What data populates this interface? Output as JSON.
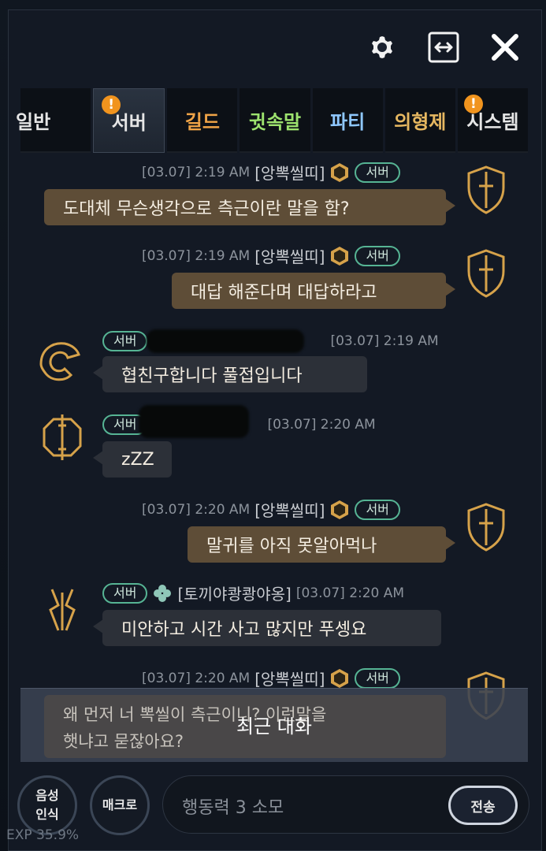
{
  "tabs": [
    {
      "label": "일반",
      "color": "#e6e6e6",
      "badge": ""
    },
    {
      "label": "서버",
      "color": "#e6e6e6",
      "badge": "!"
    },
    {
      "label": "길드",
      "color": "#f0a447",
      "badge": ""
    },
    {
      "label": "귓속말",
      "color": "#9de36e",
      "badge": ""
    },
    {
      "label": "파티",
      "color": "#8fc8ff",
      "badge": ""
    },
    {
      "label": "의형제",
      "color": "#e7b861",
      "badge": ""
    },
    {
      "label": "시스템",
      "color": "#e6e6e6",
      "badge": "!"
    }
  ],
  "messages": [
    {
      "time": "[03.07] 2:19 AM",
      "sender": "[앙뽁씰띠]",
      "channel": "서버",
      "text": "도대체 무슨생각으로 측근이란 말을 함?"
    },
    {
      "time": "[03.07] 2:19 AM",
      "sender": "[앙뽁씰띠]",
      "channel": "서버",
      "text": "대답 해준다며 대답하라고"
    },
    {
      "time": "[03.07] 2:19 AM",
      "channel": "서버",
      "text": "협친구합니다 풀접입니다"
    },
    {
      "time": "[03.07] 2:20 AM",
      "channel": "서버",
      "text": "zZZ"
    },
    {
      "time": "[03.07] 2:20 AM",
      "sender": "[앙뽁씰띠]",
      "channel": "서버",
      "text": "말귀를 아직 못알아먹나"
    },
    {
      "time": "[03.07] 2:20 AM",
      "sender": "[토끼야쾅쾅야옹]",
      "channel": "서버",
      "text": "미안하고 시간 사고 많지만 푸셍요"
    },
    {
      "time": "[03.07] 2:20 AM",
      "sender": "[앙뽁씰띠]",
      "channel": "서버"
    }
  ],
  "recent": {
    "label": "최근 대화",
    "preview_line1": "왜 먼저 너 뽁씰이 측근이니? 이런말을",
    "preview_line2": "햇냐고 묻잖아요?"
  },
  "bottom": {
    "voice_button": "음성\n인식",
    "macro_button": "매크로",
    "input_value": "행동력 3 소모",
    "send_button": "전송"
  },
  "status": {
    "exp": "EXP 35.9%"
  },
  "colors": {
    "accent_gold": "#d6a24a",
    "pill_green": "#56b494",
    "my_bubble": "#5e4d37",
    "other_bubble": "#2c3038"
  }
}
